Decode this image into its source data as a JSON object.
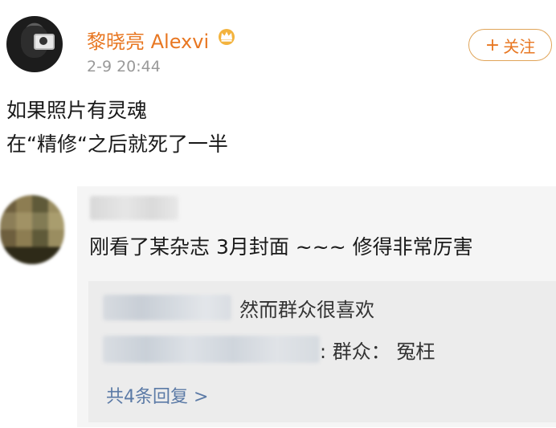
{
  "post": {
    "author": "黎晓亮 Alexvi",
    "time": "2-9 20:44",
    "follow_label": "关注",
    "text_line1": "如果照片有灵魂",
    "text_line2": "在“精修“之后就死了一半"
  },
  "comment": {
    "text": "刚看了某杂志 3月封面 ~~~ 修得非常厉害",
    "replies": [
      {
        "text": "然而群众很喜欢"
      },
      {
        "text": ": 群众： 冤枉"
      }
    ],
    "more_label": "共4条回复 >"
  },
  "colors": {
    "accent": "#e87722",
    "link": "#5b7aa6",
    "card_bg": "#f5f5f5"
  },
  "icons": [
    "crown-icon",
    "plus-icon"
  ]
}
